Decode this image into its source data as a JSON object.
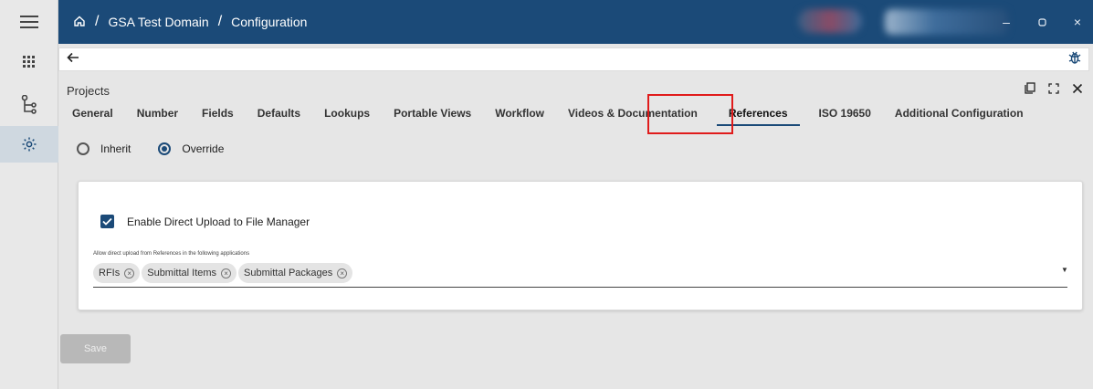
{
  "breadcrumb": {
    "home_icon": "home-icon",
    "domain": "GSA Test Domain",
    "page": "Configuration",
    "separator": "/"
  },
  "window_controls": {
    "minimize": "–",
    "restore": "▢",
    "close": "×"
  },
  "toolbar": {
    "back_icon": "arrow-left-icon",
    "right_icon": "bug-icon"
  },
  "panel": {
    "title": "Projects",
    "tabs": [
      {
        "label": "General"
      },
      {
        "label": "Number"
      },
      {
        "label": "Fields"
      },
      {
        "label": "Defaults"
      },
      {
        "label": "Lookups"
      },
      {
        "label": "Portable Views"
      },
      {
        "label": "Workflow"
      },
      {
        "label": "Videos & Documentation"
      },
      {
        "label": "References",
        "active": true
      },
      {
        "label": "ISO 19650"
      },
      {
        "label": "Additional Configuration"
      }
    ],
    "icons": {
      "popout": "popout-icon",
      "fullscreen": "fullscreen-icon",
      "close": "close-icon"
    }
  },
  "mode": {
    "options": [
      "Inherit",
      "Override"
    ],
    "selected": "Override"
  },
  "references": {
    "checkbox_label": "Enable Direct Upload to File Manager",
    "checkbox_checked": true,
    "field_label": "Allow direct upload from References in the following applications",
    "chips": [
      "RFIs",
      "Submittal Items",
      "Submittal Packages"
    ]
  },
  "save_label": "Save",
  "colors": {
    "topbar": "#1b4a78",
    "accent": "#1b4a78",
    "highlight": "#e01b1b"
  }
}
